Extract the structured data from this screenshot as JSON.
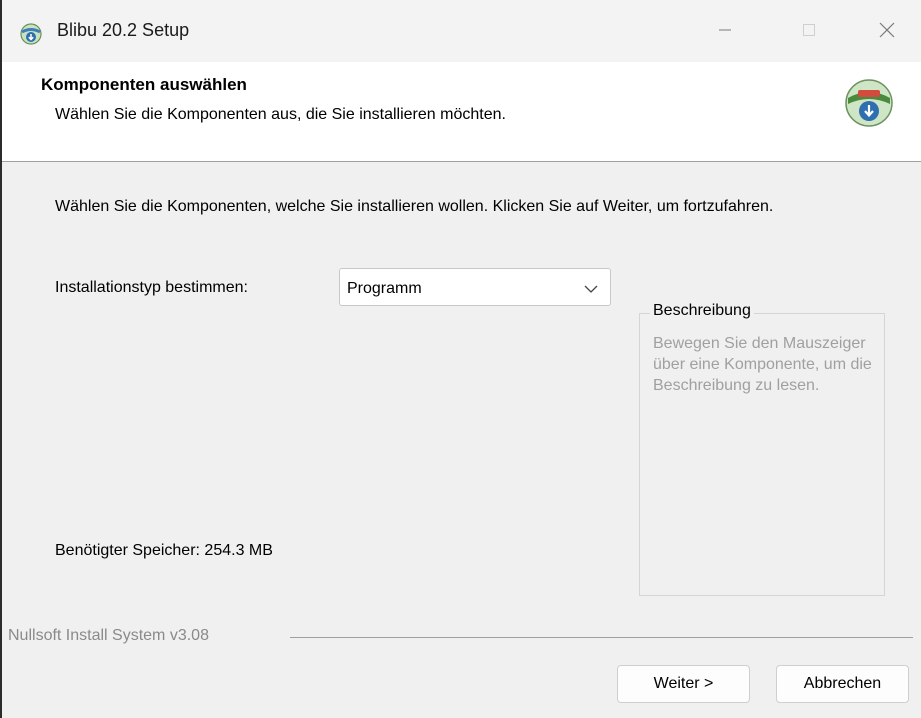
{
  "window": {
    "title": "Blibu 20.2 Setup"
  },
  "header": {
    "title": "Komponenten auswählen",
    "subtitle": "Wählen Sie die Komponenten aus, die Sie installieren möchten."
  },
  "main": {
    "intro": "Wählen Sie die Komponenten, welche Sie installieren wollen. Klicken Sie auf Weiter, um fortzufahren.",
    "install_type_label": "Installationstyp bestimmen:",
    "install_type_value": "Programm",
    "description": {
      "title": "Beschreibung",
      "text": "Bewegen Sie den Mauszeiger über eine Komponente, um die Beschreibung zu lesen."
    },
    "space_required": "Benötigter Speicher: 254.3 MB"
  },
  "footer": {
    "brand": "Nullsoft Install System v3.08",
    "next_label": "Weiter >",
    "cancel_label": "Abbrechen"
  },
  "icons": {
    "app": "installer-globe-icon",
    "header_logo": "nsis-logo-icon",
    "minimize": "minimize-icon",
    "maximize": "maximize-icon",
    "close": "close-icon",
    "dropdown": "chevron-down-icon"
  }
}
